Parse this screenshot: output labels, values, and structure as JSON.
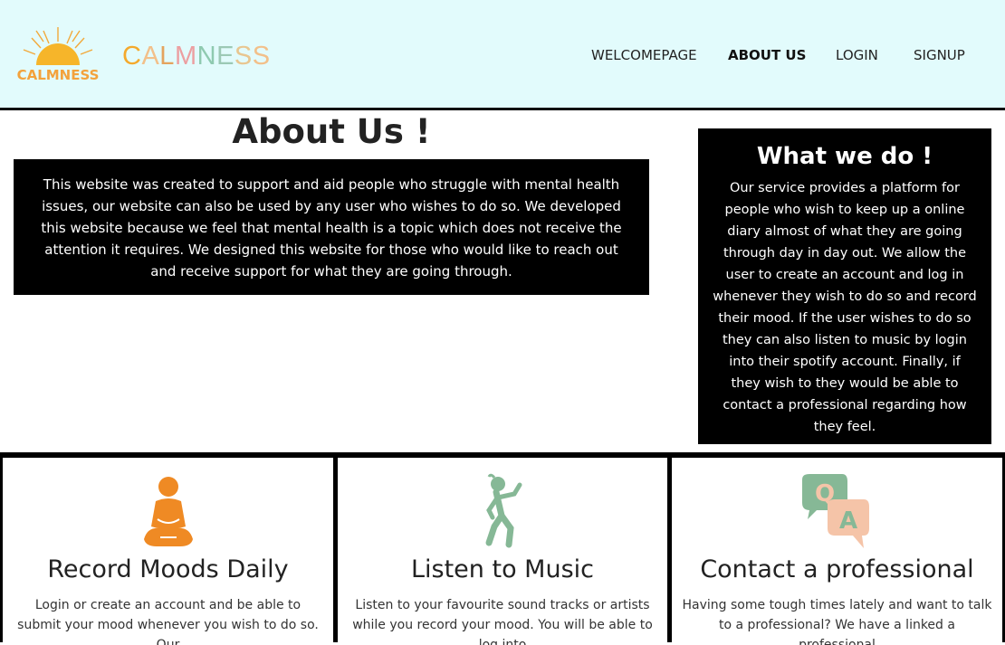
{
  "header": {
    "logo_text": "CALMNESS",
    "brand_letters": [
      "C",
      "A",
      "L",
      "M",
      "N",
      "E",
      "S",
      "S"
    ],
    "brand_colors": [
      "#f4a92c",
      "#f2c08a",
      "#e4a35e",
      "#ec9fa1",
      "#8fcab0",
      "#9cc9b5",
      "#e8c690",
      "#f2c08a"
    ],
    "nav": [
      "WELCOMEPAGE",
      "ABOUT US",
      "LOGIN",
      "SIGNUP"
    ],
    "active_nav": "ABOUT US"
  },
  "about": {
    "title": "About Us !",
    "text": "This website was created to support and aid people who struggle with mental health issues, our website can also be used by any user who wishes to do so. We developed this website because we feel that mental health is a topic which does not receive the attention it requires. We designed this website for those who would like to reach out and receive support for what they are going through."
  },
  "what_we_do": {
    "title": "What we do !",
    "text": "Our service provides a platform for people who wish to keep up a online diary almost of what they are going through day in day out. We allow the user to create an account and log in whenever they wish to do so and record their mood. If the user wishes to do so they can also listen to music by login into their spotify account. Finally, if they wish to they would be able to contact a professional regarding how they feel."
  },
  "features": [
    {
      "icon": "meditation-icon",
      "title": "Record Moods Daily",
      "text": "Login or create an account and be able to submit your mood whenever you wish to do so. Our"
    },
    {
      "icon": "dancing-person-icon",
      "title": "Listen to Music",
      "text": "Listen to your favourite sound tracks or artists while you record your mood. You will be able to log into"
    },
    {
      "icon": "qa-chat-icon",
      "title": "Contact a professional",
      "text": "Having some tough times lately and want to talk to a professional? We have a linked a professional"
    }
  ],
  "colors": {
    "header_bg": "#e2fbfc",
    "orange": "#ef8a24",
    "green": "#86b896",
    "peach": "#f5c4a8"
  }
}
